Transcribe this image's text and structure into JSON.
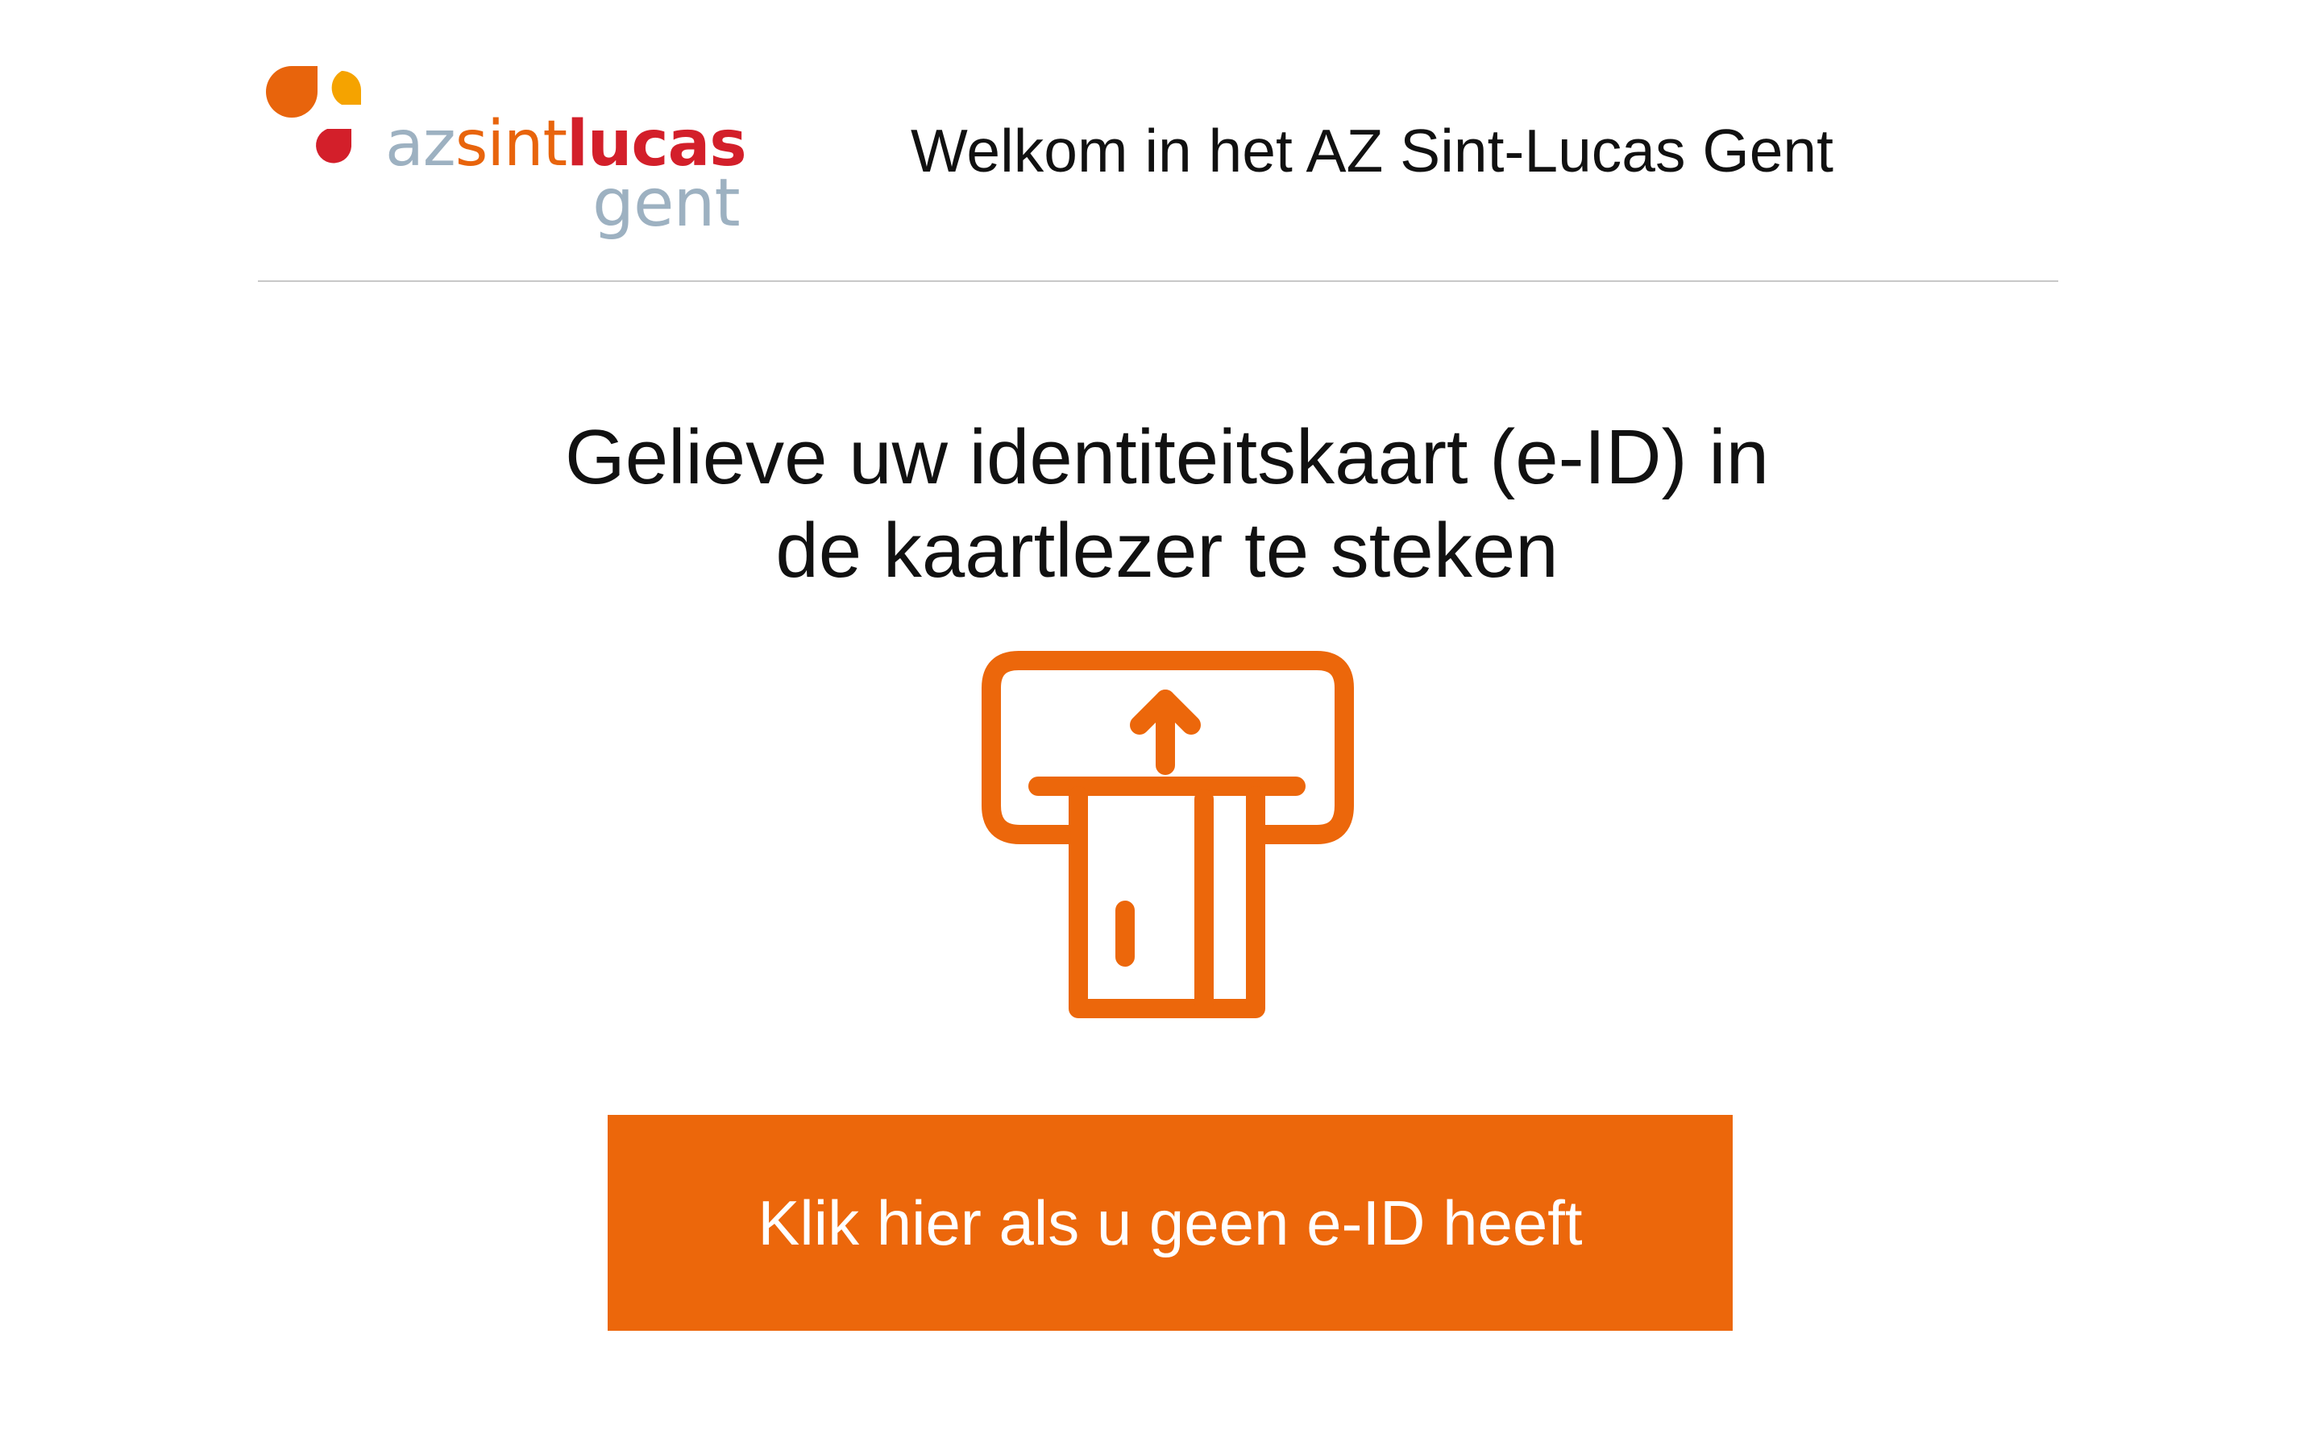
{
  "header": {
    "logo": {
      "word_az": "az",
      "word_sint": "sint",
      "word_lucas": "lucas",
      "word_gent": "gent"
    },
    "welcome": "Welkom in het AZ Sint-Lucas Gent"
  },
  "main": {
    "instruction_line1": "Gelieve uw identiteitskaart (e-ID) in",
    "instruction_line2": "de kaartlezer te steken",
    "icon": "card-reader-insert-icon",
    "no_eid_button_label": "Klik hier als u geen e-ID heeft"
  },
  "colors": {
    "accent": "#ec670b",
    "logo_red": "#d31f2a",
    "logo_yellow": "#f5a300",
    "logo_grey": "#9db1c1"
  }
}
